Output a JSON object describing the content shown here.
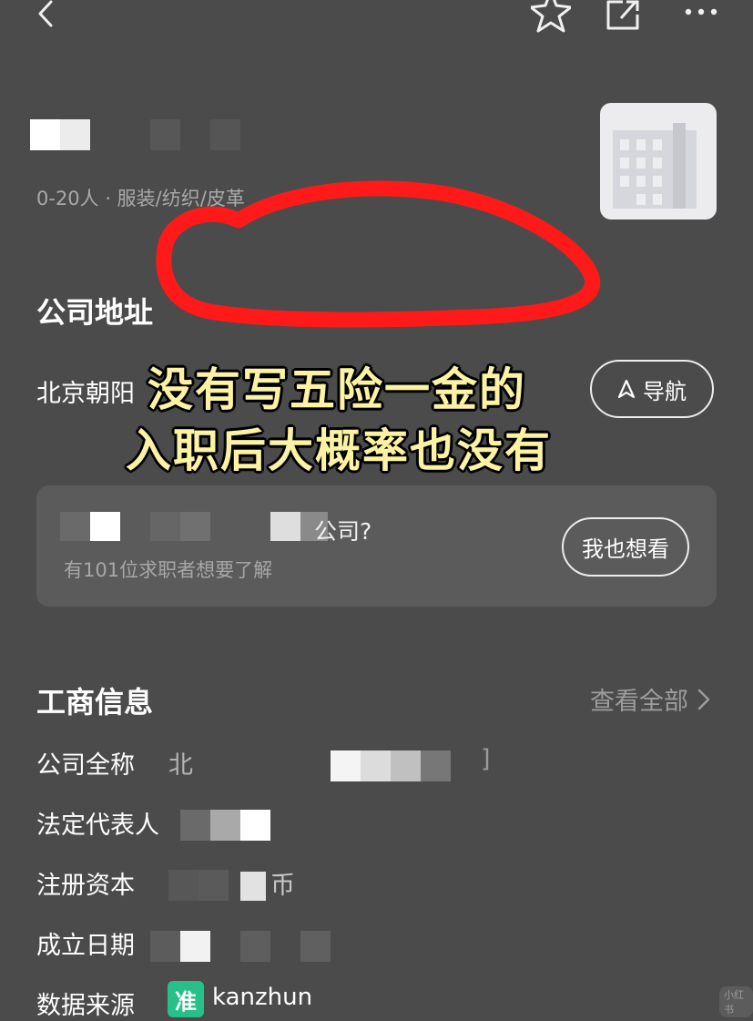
{
  "header": {
    "back_icon": "chevron-left-icon",
    "favorite_icon": "star-icon",
    "share_icon": "share-icon",
    "more_icon": "more-dots-icon"
  },
  "company": {
    "meta": "0-20人 · 服装/纺织/皮革",
    "logo_icon": "building-icon"
  },
  "address": {
    "title": "公司地址",
    "text": "北京朝阳",
    "nav_label": "导航"
  },
  "caption": {
    "line1": "没有写五险一金的",
    "line2": "入职后大概率也没有"
  },
  "interest_card": {
    "title_suffix": "公司?",
    "subtitle": "有101位求职者想要了解",
    "button_label": "我也想看"
  },
  "business_info": {
    "title": "工商信息",
    "view_all": "查看全部",
    "rows": [
      {
        "label": "公司全称",
        "value_prefix": "北",
        "value_suffix": "]"
      },
      {
        "label": "法定代表人",
        "value_prefix": "",
        "value_suffix": ""
      },
      {
        "label": "注册资本",
        "value_prefix": "",
        "value_suffix": "币"
      },
      {
        "label": "成立日期",
        "value_prefix": "",
        "value_suffix": ""
      },
      {
        "label": "数据来源",
        "value_prefix": "",
        "value_suffix": ""
      }
    ],
    "source_badge": "准",
    "source_name": "kanzhun"
  },
  "colors": {
    "background": "#4b4b4b",
    "card": "#5b5b5b",
    "annotation_red": "#ff1a1a",
    "caption_yellow": "#fbf3a3",
    "kanzhun_green": "#27c08a"
  },
  "watermark": "小红书"
}
